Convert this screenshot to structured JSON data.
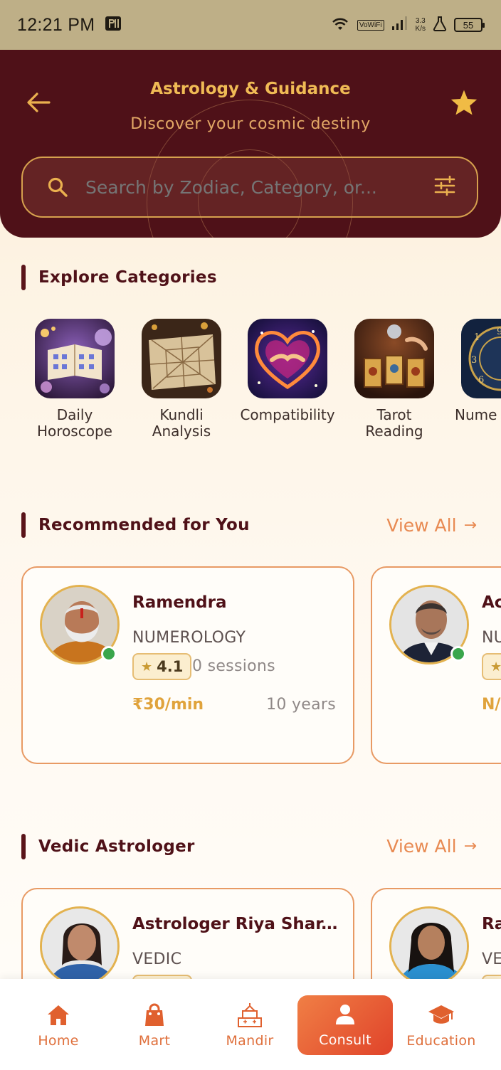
{
  "status_bar": {
    "time": "12:21 PM",
    "vowifi": "VoWiFi",
    "net_speed_value": "3.3",
    "net_speed_unit": "K/s",
    "battery": "55"
  },
  "header": {
    "title": "Astrology & Guidance",
    "subtitle": "Discover your cosmic destiny",
    "search_placeholder": "Search by Zodiac, Category, or..."
  },
  "categories": {
    "title": "Explore Categories",
    "items": [
      {
        "label_line1": "Daily",
        "label_line2": "Horoscope"
      },
      {
        "label_line1": "Kundli",
        "label_line2": "Analysis"
      },
      {
        "label_line1": "Compatibility",
        "label_line2": ""
      },
      {
        "label_line1": "Tarot",
        "label_line2": "Reading"
      },
      {
        "label_line1": "Nume",
        "label_line2": ""
      }
    ]
  },
  "recommended": {
    "title": "Recommended for You",
    "view_all": "View All",
    "arrow": "→",
    "cards": [
      {
        "name": "Ramendra",
        "category": "NUMEROLOGY",
        "rating": "4.1",
        "sessions": "0 sessions",
        "price": "₹30/min",
        "experience": "10 years"
      },
      {
        "name": "Ac",
        "category": "NU",
        "rating": "",
        "sessions": "",
        "price": "N/",
        "experience": ""
      }
    ]
  },
  "vedic": {
    "title": "Vedic Astrologer",
    "view_all": "View All",
    "arrow": "→",
    "cards": [
      {
        "name": "Astrologer Riya Shar...",
        "category": "VEDIC"
      },
      {
        "name": "Ra",
        "category": "VE"
      }
    ]
  },
  "bottom_nav": {
    "items": [
      {
        "label": "Home",
        "icon": "home-icon"
      },
      {
        "label": "Mart",
        "icon": "shopping-bag-icon"
      },
      {
        "label": "Mandir",
        "icon": "temple-icon"
      },
      {
        "label": "Consult",
        "icon": "person-icon",
        "active": true
      },
      {
        "label": "Education",
        "icon": "graduation-cap-icon"
      }
    ]
  },
  "colors": {
    "header_bg": "#4f1118",
    "accent_gold": "#f0bb55",
    "accent_orange": "#e88a52",
    "online_green": "#3aa64c"
  }
}
